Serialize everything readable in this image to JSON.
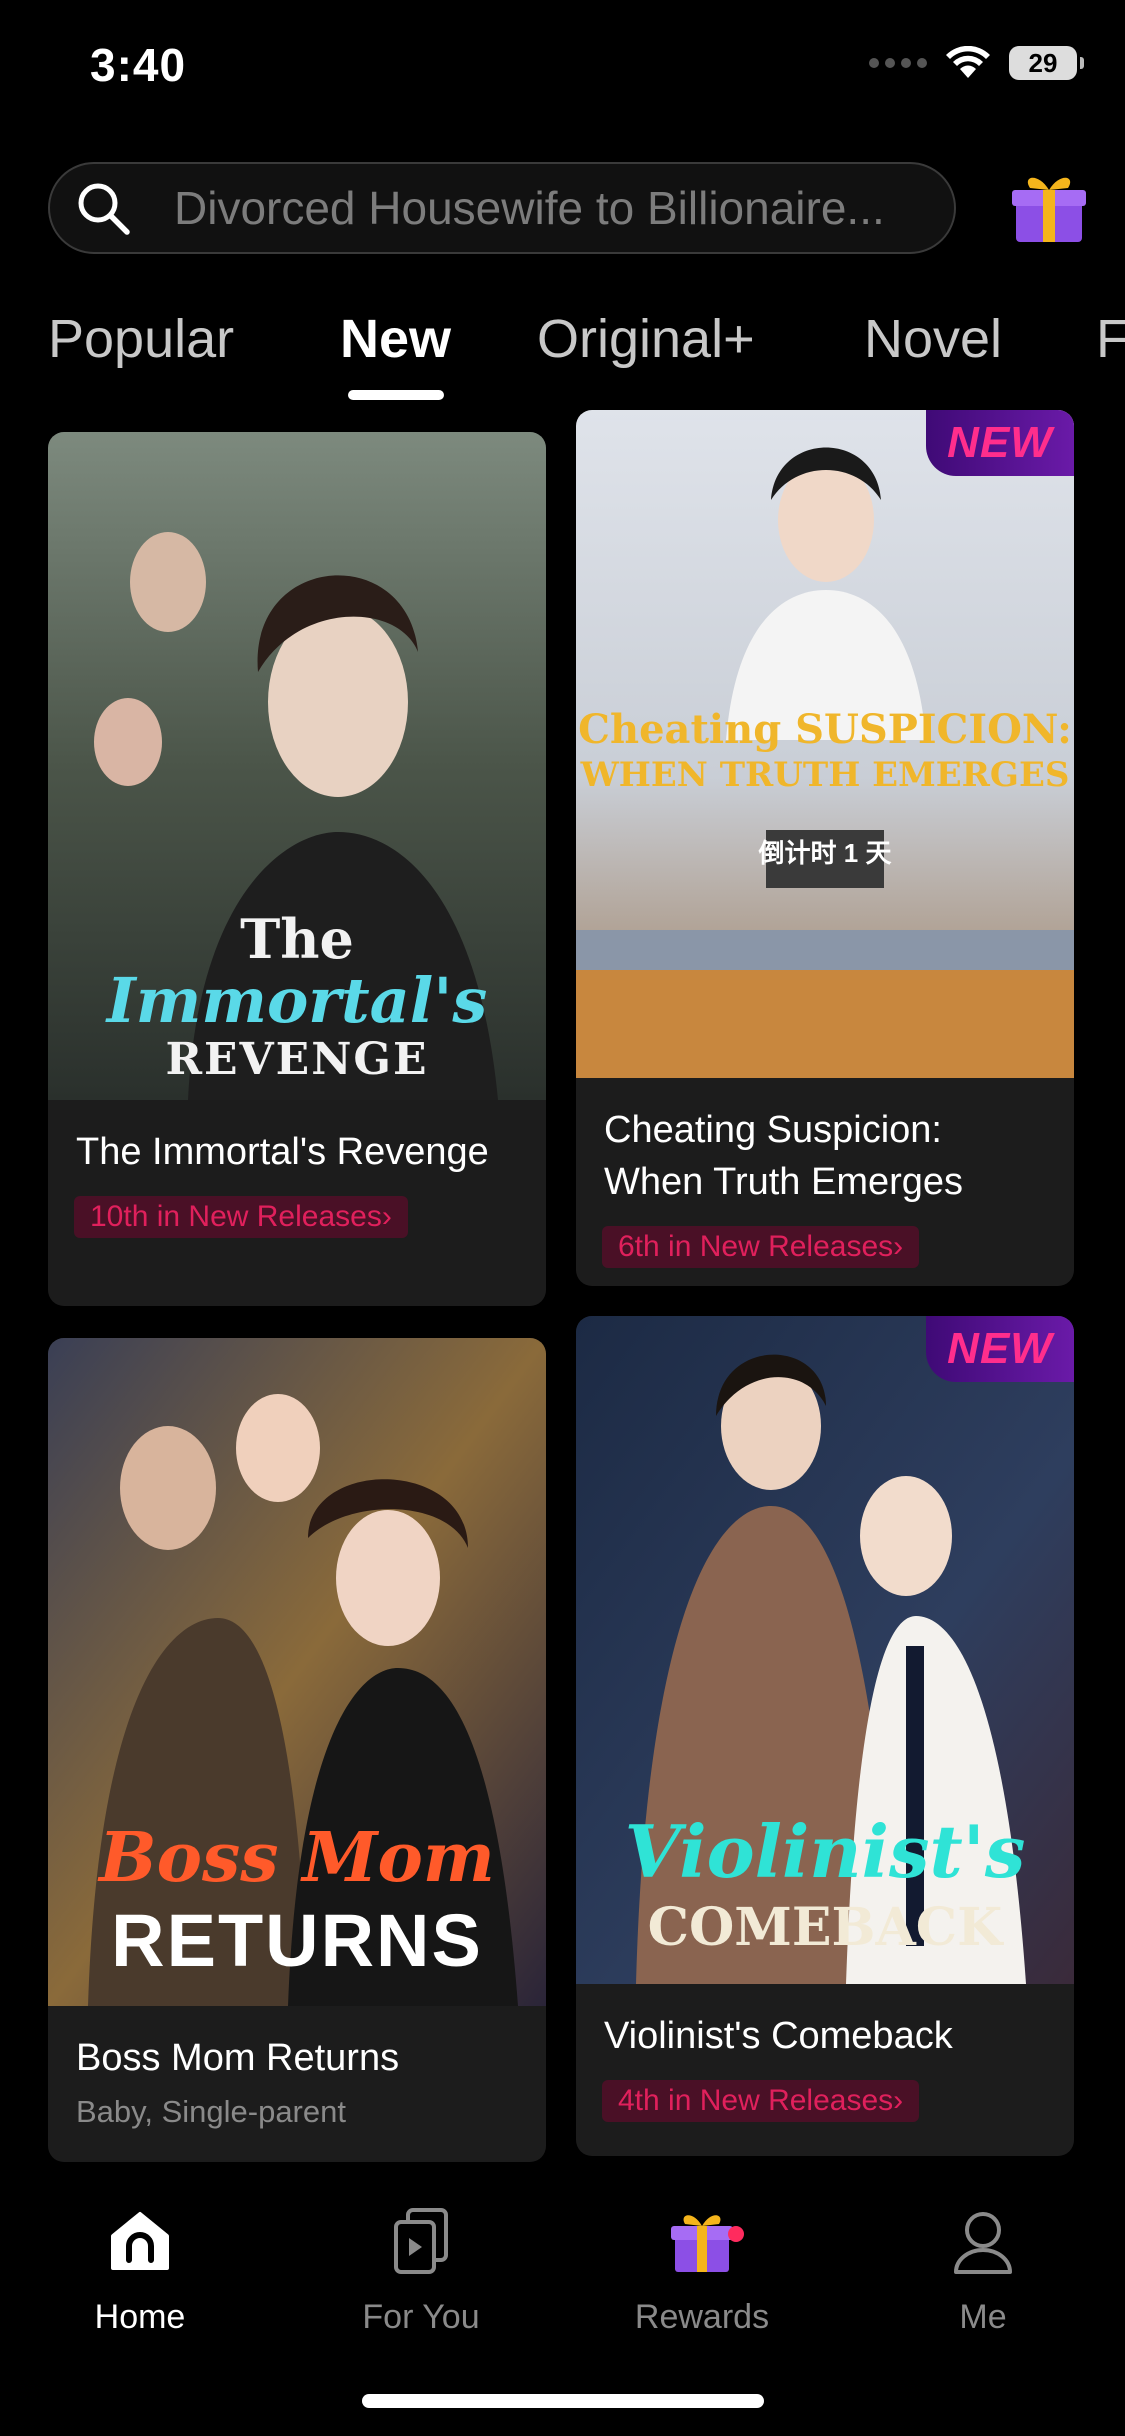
{
  "status_bar": {
    "time": "3:40",
    "battery": "29"
  },
  "search": {
    "placeholder": "Divorced Housewife to Billionaire..."
  },
  "tabs": [
    {
      "label": "Popular"
    },
    {
      "label": "New"
    },
    {
      "label": "Original+"
    },
    {
      "label": "Novel"
    },
    {
      "label": "F"
    }
  ],
  "cards": [
    {
      "title": "The Immortal's Revenge",
      "rank": "10th in New Releases›",
      "poster_line1": "The",
      "poster_line2": "Immortal's",
      "poster_line3": "REVENGE"
    },
    {
      "title": "Cheating Suspicion: When Truth Emerges",
      "badge": "NEW",
      "rank": "6th in New Releases›",
      "poster_line1": "Cheating SUSPICION:",
      "poster_line2": "WHEN TRUTH EMERGES",
      "poster_line3": "倒计时 1 天"
    },
    {
      "title": "Boss Mom Returns",
      "tags": "Baby, Single-parent",
      "poster_line1": "Boss Mom",
      "poster_line2": "RETURNS"
    },
    {
      "title": "Violinist's Comeback",
      "badge": "NEW",
      "rank": "4th in New Releases›",
      "poster_line1": "Violinist's",
      "poster_line2": "COMEBACK"
    }
  ],
  "bottom_nav": [
    {
      "label": "Home",
      "icon": "home-icon"
    },
    {
      "label": "For You",
      "icon": "for-you-icon"
    },
    {
      "label": "Rewards",
      "icon": "gift-icon"
    },
    {
      "label": "Me",
      "icon": "profile-icon"
    }
  ],
  "colors": {
    "accent": "#e0205c",
    "rank_badge_bg": "#4a1026",
    "new_badge_text": "#ff2e8c",
    "new_badge_bg": "#4f1090",
    "card_bg": "#1c1c1c",
    "background": "#000000"
  }
}
